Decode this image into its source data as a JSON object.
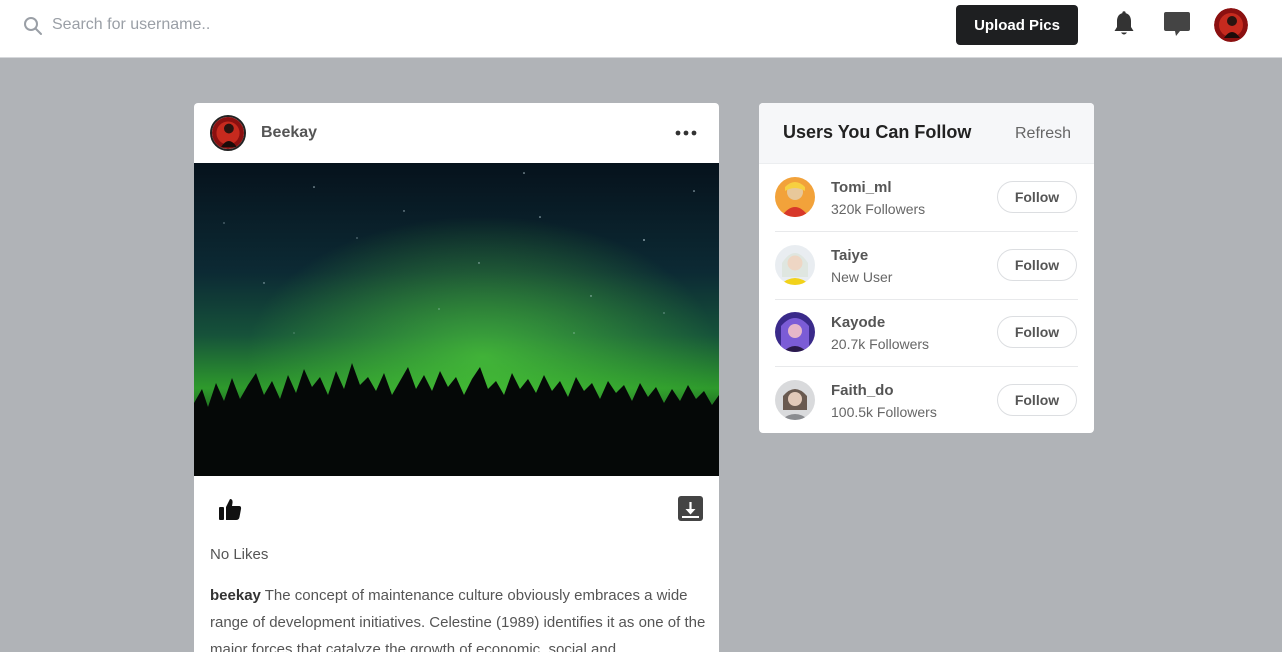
{
  "header": {
    "search": {
      "placeholder": "Search for username.."
    },
    "upload_label": "Upload Pics",
    "icons": [
      "search-icon",
      "bell-icon",
      "chat-icon",
      "avatar"
    ]
  },
  "post": {
    "username": "Beekay",
    "likes_text": "No Likes",
    "caption_user": "beekay",
    "caption_text": " The concept of maintenance culture obviously embraces a wide range of development initiatives. Celestine (1989) identifies it as one of the major forces that catalyze the growth of economic, social and"
  },
  "suggestions": {
    "title": "Users You Can Follow",
    "refresh_label": "Refresh",
    "users": [
      {
        "name": "Tomi_ml",
        "subtitle": "320k Followers",
        "button": "Follow"
      },
      {
        "name": "Taiye",
        "subtitle": "New User",
        "button": "Follow"
      },
      {
        "name": "Kayode",
        "subtitle": "20.7k Followers",
        "button": "Follow"
      },
      {
        "name": "Faith_do",
        "subtitle": "100.5k Followers",
        "button": "Follow"
      }
    ]
  },
  "colors": {
    "page_background": "#b0b3b7",
    "upload_button": "#1e1f21",
    "aurora_green": "#2fa02a"
  }
}
